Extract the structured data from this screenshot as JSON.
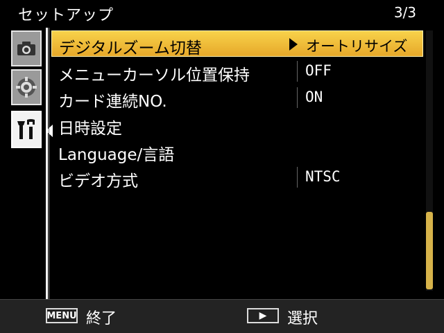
{
  "header": {
    "title": "セットアップ",
    "page": "3/3"
  },
  "tabs": [
    {
      "icon": "camera-icon"
    },
    {
      "icon": "mode-dial-icon"
    },
    {
      "icon": "tools-icon",
      "active": true
    }
  ],
  "menu": {
    "items": [
      {
        "label": "デジタルズーム切替",
        "value": "オートリサイズ",
        "selected": true
      },
      {
        "label": "メニューカーソル位置保持",
        "value": "OFF"
      },
      {
        "label": "カード連続NO.",
        "value": "ON"
      },
      {
        "label": "日時設定",
        "value": ""
      },
      {
        "label": "Language/言語",
        "value": ""
      },
      {
        "label": "ビデオ方式",
        "value": "NTSC"
      }
    ]
  },
  "footer": {
    "menu_key": "MENU",
    "menu_action": "終了",
    "play_key": "▶",
    "play_action": "選択"
  },
  "colors": {
    "highlight": "#f0bf3a",
    "scrollbar": "#d7b34a"
  }
}
